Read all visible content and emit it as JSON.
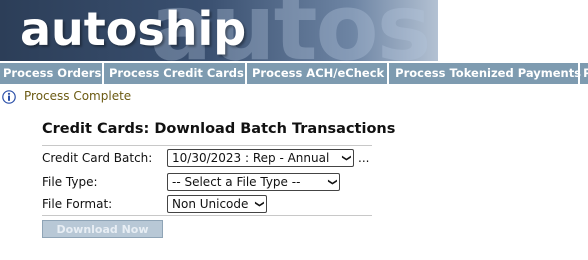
{
  "header": {
    "logo_text": "autoship",
    "watermark_text": "autoship"
  },
  "nav": {
    "tabs": [
      {
        "label": "Process Orders"
      },
      {
        "label": "Process Credit Cards"
      },
      {
        "label": "Process ACH/eCheck"
      },
      {
        "label": "Process Tokenized Payments"
      },
      {
        "label": "P"
      }
    ]
  },
  "status": {
    "icon": "info-icon",
    "message": "Process Complete"
  },
  "form": {
    "title": "Credit Cards: Download Batch Transactions",
    "batch_label": "Credit Card Batch:",
    "batch_value": "10/30/2023 : Rep - Annual",
    "batch_more": "...",
    "file_type_label": "File Type:",
    "file_type_value": "-- Select a File Type --",
    "file_format_label": "File Format:",
    "file_format_value": "Non Unicode",
    "download_label": "Download Now"
  },
  "colors": {
    "nav_bg": "#7e9bb0",
    "status_text": "#6b5a12",
    "button_disabled_bg": "#b8c8d6"
  }
}
